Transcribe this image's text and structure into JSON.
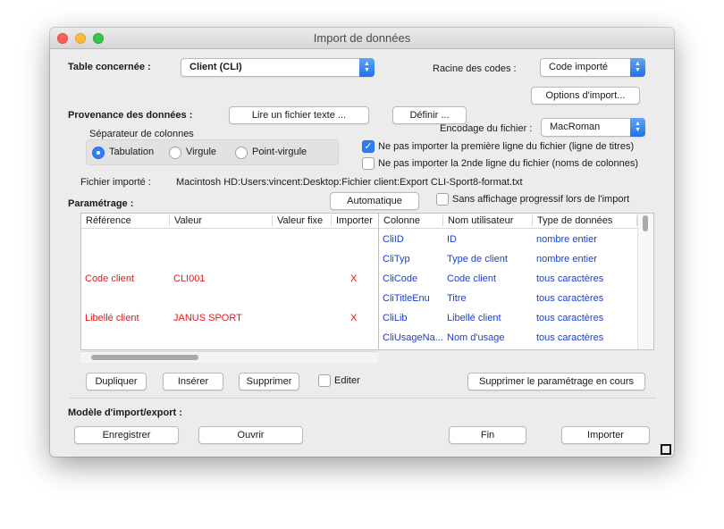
{
  "window": {
    "title": "Import de données"
  },
  "table_concernee": {
    "label": "Table concernée :",
    "value": "Client  (CLI)"
  },
  "racine": {
    "label": "Racine des codes :",
    "value": "Code importé"
  },
  "options_btn": "Options d'import...",
  "provenance": {
    "label": "Provenance des données :",
    "lire_btn": "Lire un fichier texte ...",
    "definir_btn": "Définir ..."
  },
  "encodage": {
    "label": "Encodage du fichier :",
    "value": "MacRoman"
  },
  "separateur": {
    "label": "Séparateur de colonnes",
    "options": [
      "Tabulation",
      "Virgule",
      "Point-virgule"
    ],
    "selected": "Tabulation"
  },
  "checks": {
    "premiere_ligne": {
      "label": "Ne pas importer la première ligne du fichier (ligne de titres)",
      "checked": true
    },
    "seconde_ligne": {
      "label": "Ne pas importer la 2nde ligne du fichier (noms de colonnes)",
      "checked": false
    },
    "sans_affichage": {
      "label": "Sans affichage progressif lors de l'import",
      "checked": false
    },
    "editer": {
      "label": "Editer",
      "checked": false
    }
  },
  "fichier": {
    "label": "Fichier importé :",
    "value": "Macintosh HD:Users:vincent:Desktop:Fichier client:Export CLI-Sport8-format.txt"
  },
  "parametrage": {
    "label": "Paramétrage :",
    "auto_btn": "Automatique"
  },
  "left_table": {
    "headers": [
      "Référence",
      "Valeur",
      "Valeur fixe",
      "Importer"
    ],
    "rows": [
      {
        "ref": "Code client",
        "valeur": "CLI001",
        "fixe": "",
        "importer": "X"
      },
      {
        "ref": "Libellé client",
        "valeur": "JANUS SPORT",
        "fixe": "",
        "importer": "X"
      }
    ]
  },
  "right_table": {
    "headers": [
      "Colonne",
      "Nom utilisateur",
      "Type de données"
    ],
    "rows": [
      {
        "col": "CliID",
        "nom": "ID",
        "type": "nombre entier"
      },
      {
        "col": "CliTyp",
        "nom": "Type de client",
        "type": "nombre entier"
      },
      {
        "col": "CliCode",
        "nom": "Code client",
        "type": "tous caractères"
      },
      {
        "col": "CliTitleEnu",
        "nom": "Titre",
        "type": "tous caractères"
      },
      {
        "col": "CliLib",
        "nom": "Libellé client",
        "type": "tous caractères"
      },
      {
        "col": "CliUsageNa...",
        "nom": "Nom d'usage",
        "type": "tous caractères"
      }
    ]
  },
  "actions": {
    "dupliquer": "Dupliquer",
    "inserer": "Insérer",
    "supprimer": "Supprimer",
    "supprimer_param": "Supprimer le paramétrage en cours"
  },
  "modele": {
    "label": "Modèle d'import/export :",
    "enregistrer": "Enregistrer",
    "ouvrir": "Ouvrir",
    "fin": "Fin",
    "importer": "Importer"
  },
  "colors": {
    "accent": "#2e7df6",
    "red_text": "#e01b1b",
    "blue_text": "#1c3fd0"
  }
}
